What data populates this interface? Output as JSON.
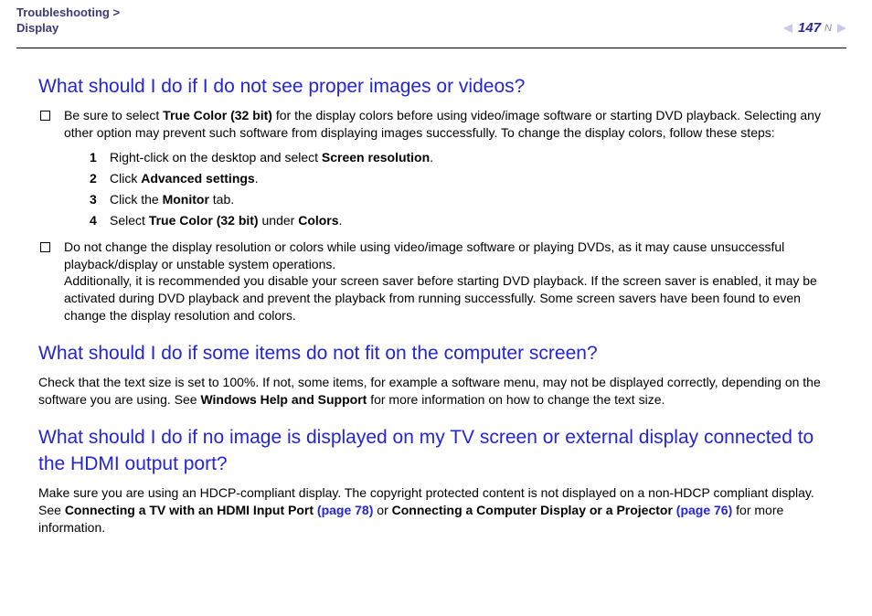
{
  "header": {
    "breadcrumb_section": "Troubleshooting",
    "breadcrumb_sep": " > ",
    "breadcrumb_page": "Display",
    "page_number": "147",
    "n_label": "n",
    "N_label": "N"
  },
  "sections": {
    "q1": {
      "title": "What should I do if I do not see proper images or videos?",
      "bullet1_pre": "Be sure to select ",
      "bullet1_bold1": "True Color (32 bit)",
      "bullet1_post": " for the display colors before using video/image software or starting DVD playback. Selecting any other option may prevent such software from displaying images successfully. To change the display colors, follow these steps:",
      "step1_pre": "Right-click on the desktop and select ",
      "step1_bold": "Screen resolution",
      "step1_post": ".",
      "step2_pre": "Click ",
      "step2_bold": "Advanced settings",
      "step2_post": ".",
      "step3_pre": "Click the ",
      "step3_bold": "Monitor",
      "step3_post": " tab.",
      "step4_pre": "Select ",
      "step4_bold1": "True Color (32 bit)",
      "step4_mid": " under ",
      "step4_bold2": "Colors",
      "step4_post": ".",
      "bullet2_a": "Do not change the display resolution or colors while using video/image software or playing DVDs, as it may cause unsuccessful playback/display or unstable system operations.",
      "bullet2_b": "Additionally, it is recommended you disable your screen saver before starting DVD playback. If the screen saver is enabled, it may be activated during DVD playback and prevent the playback from running successfully. Some screen savers have been found to even change the display resolution and colors."
    },
    "q2": {
      "title": "What should I do if some items do not fit on the computer screen?",
      "body_pre": "Check that the text size is set to 100%. If not, some items, for example a software menu, may not be displayed correctly, depending on the software you are using. See ",
      "body_bold": "Windows Help and Support",
      "body_post": " for more information on how to change the text size."
    },
    "q3": {
      "title": "What should I do if no image is displayed on my TV screen or external display connected to the HDMI output port?",
      "body_pre": "Make sure you are using an HDCP-compliant display. The copyright protected content is not displayed on a non-HDCP compliant display. See ",
      "link1_bold": "Connecting a TV with an HDMI Input Port ",
      "link1_page": "(page 78)",
      "body_mid": " or ",
      "link2_bold": "Connecting a Computer Display or a Projector ",
      "link2_page": "(page 76)",
      "body_post": " for more information."
    }
  }
}
